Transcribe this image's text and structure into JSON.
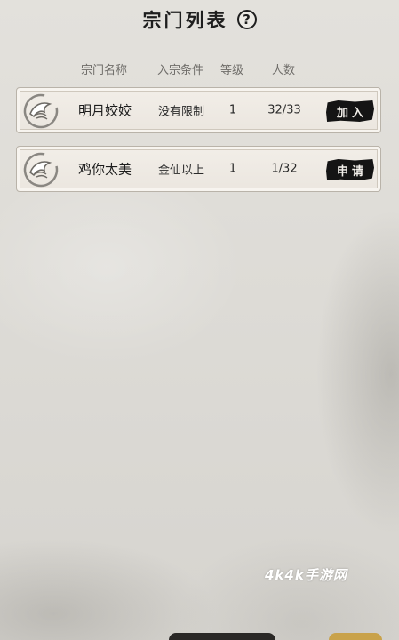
{
  "title": "宗门列表",
  "help_icon": "question-circle-icon",
  "header": {
    "name": "宗门名称",
    "condition": "入宗条件",
    "level": "等级",
    "count": "人数"
  },
  "sects": [
    {
      "emblem": "crane-emblem-icon",
      "name": "明月姣姣",
      "condition": "没有限制",
      "level": "1",
      "count": "32/33",
      "action": "加入"
    },
    {
      "emblem": "crane-emblem-icon",
      "name": "鸡你太美",
      "condition": "金仙以上",
      "level": "1",
      "count": "1/32",
      "action": "申请"
    }
  ],
  "watermark": "4k4k手游网"
}
